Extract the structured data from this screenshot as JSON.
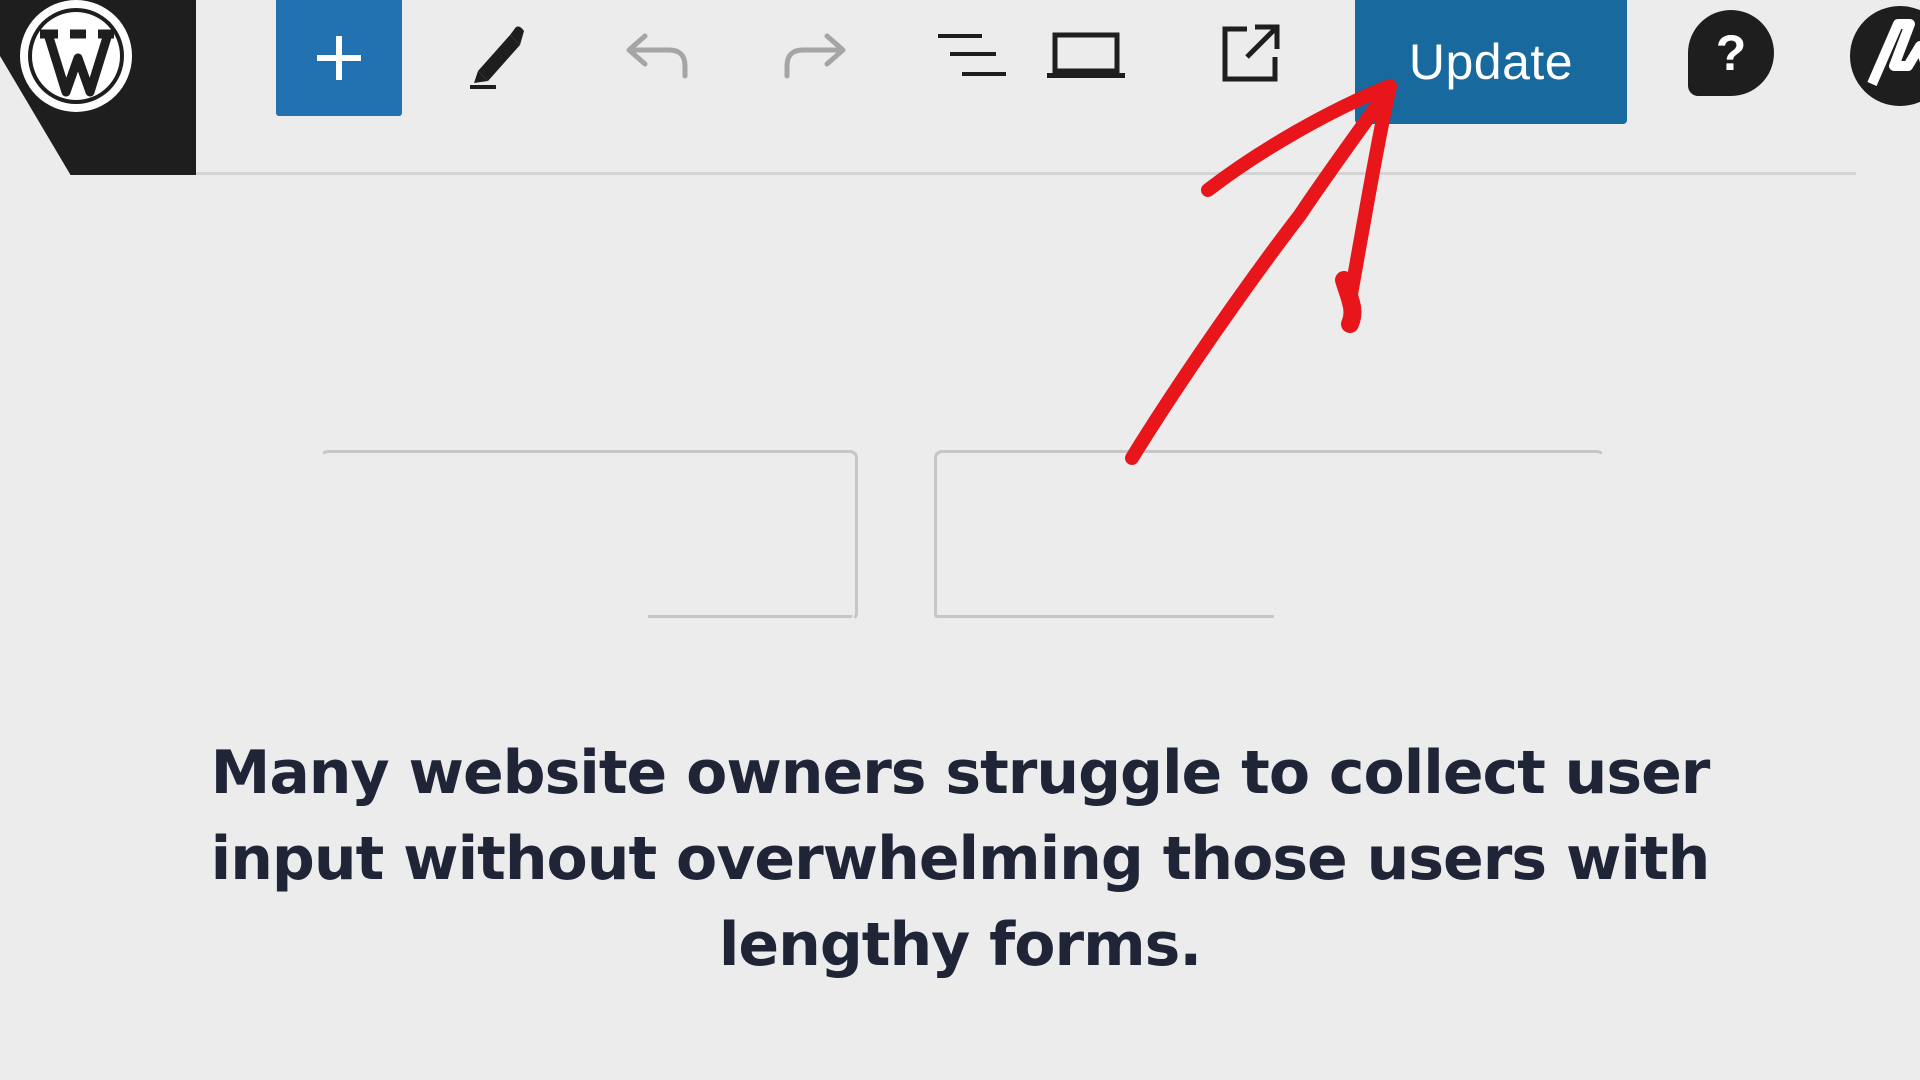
{
  "toolbar": {
    "logo_icon": "wordpress-logo-icon",
    "inserter_icon": "plus-icon",
    "tools_icon": "pencil-icon",
    "undo_icon": "undo-icon",
    "redo_icon": "redo-icon",
    "list_view_icon": "list-view-icon",
    "preview_icon": "laptop-icon",
    "view_post_icon": "external-link-icon",
    "update_label": "Update",
    "help_label": "?",
    "account_icon": "astra-avatar-icon",
    "accent_color": "#17699e"
  },
  "annotation": {
    "arrow_color": "#e8161b"
  },
  "caption": {
    "text": "Many website owners struggle to collect user input without overwhelming those users with lengthy forms."
  }
}
